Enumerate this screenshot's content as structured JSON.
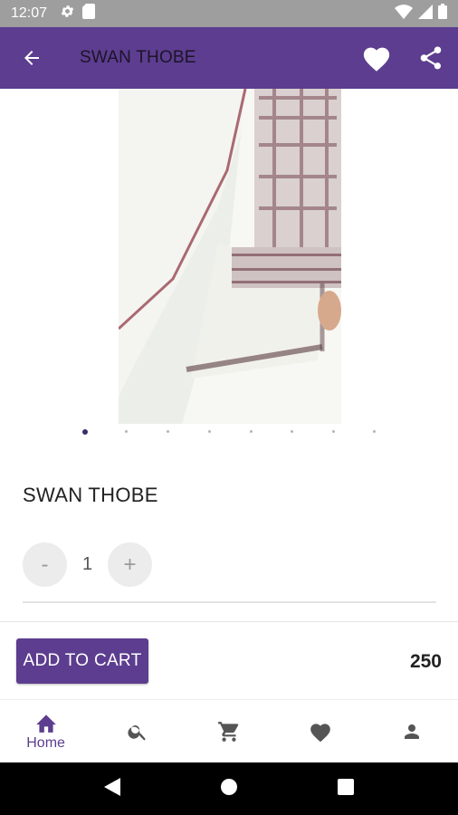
{
  "status_bar": {
    "time": "12:07",
    "icons": [
      "gear-icon",
      "sd-card-icon"
    ],
    "right_icons": [
      "wifi-icon",
      "signal-icon",
      "battery-icon"
    ]
  },
  "app_bar": {
    "title": "SWAN THOBE",
    "back_icon": "arrow-left-icon",
    "actions": [
      "heart-icon",
      "share-icon"
    ],
    "color": "#5c3d8f"
  },
  "gallery": {
    "image_description": "product-photo",
    "page_count": 8,
    "active_index": 0
  },
  "product": {
    "name": "SWAN THOBE",
    "quantity": "1",
    "decrement_label": "-",
    "increment_label": "+",
    "price": "250"
  },
  "cart": {
    "add_label": "ADD TO CART"
  },
  "bottom_nav": {
    "items": [
      {
        "icon": "home-icon",
        "label": "Home",
        "active": true
      },
      {
        "icon": "search-icon",
        "label": ""
      },
      {
        "icon": "cart-icon",
        "label": ""
      },
      {
        "icon": "heart-icon",
        "label": ""
      },
      {
        "icon": "person-icon",
        "label": ""
      }
    ]
  },
  "colors": {
    "primary": "#5c3d8f",
    "status_bar": "#9e9e9e",
    "active_dot": "#3d2b6e"
  }
}
